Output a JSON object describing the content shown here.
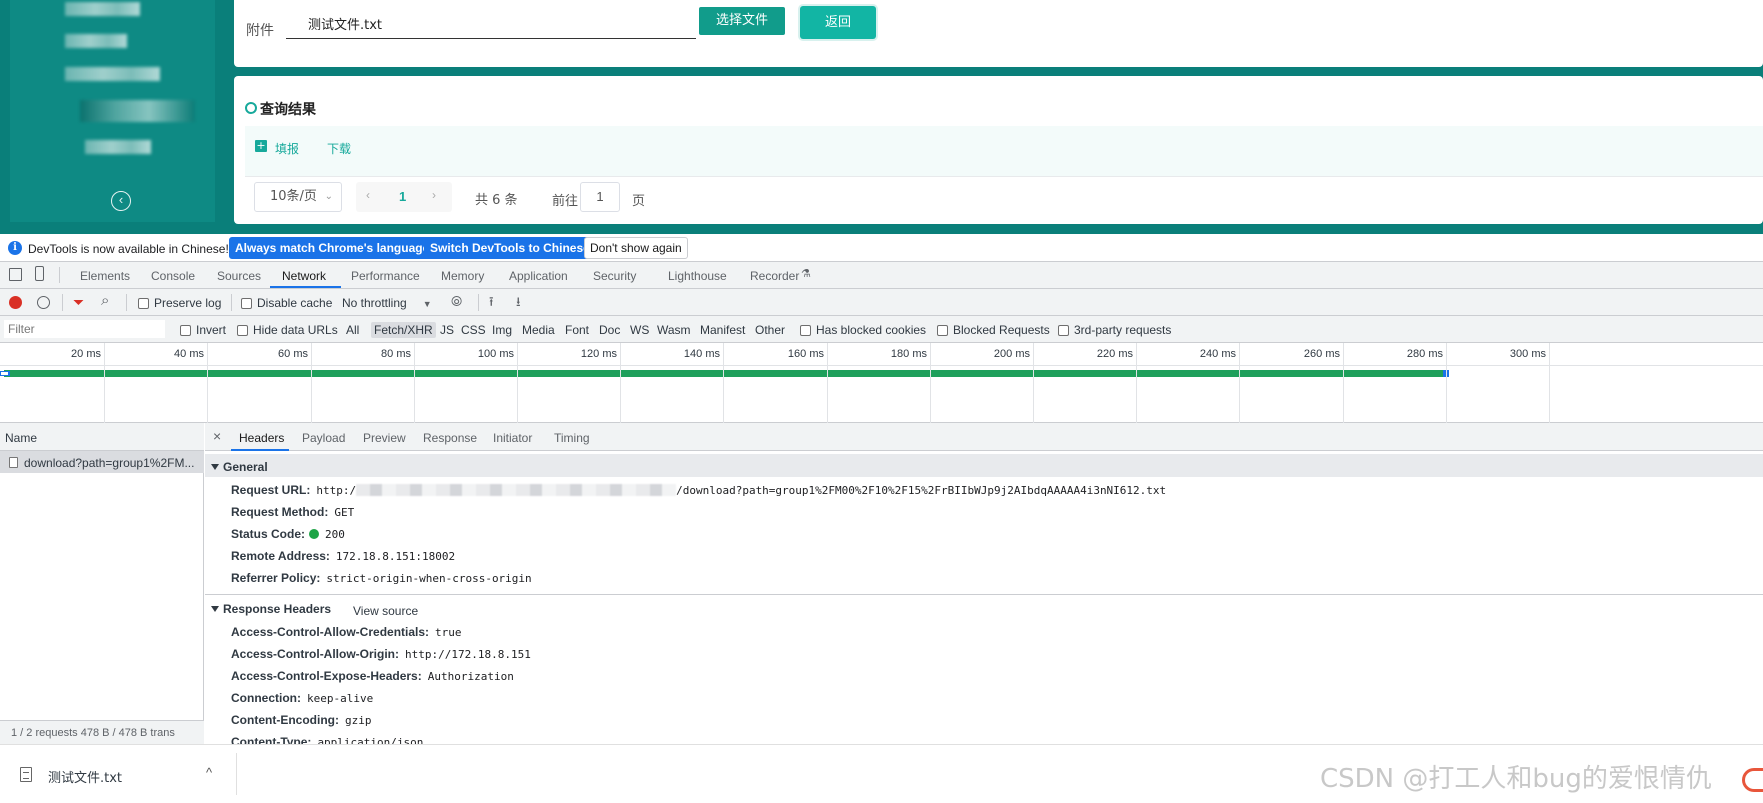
{
  "app": {
    "attachment_label": "附件",
    "file_value": "测试文件.txt",
    "choose_file_button": "选择文件",
    "back_button": "返回",
    "result_title": "查询结果",
    "fill_link": "填报",
    "download_link": "下载",
    "page_size": "10条/页",
    "prev_glyph": "‹",
    "next_glyph": "›",
    "current_page": "1",
    "total_text": "共 6 条",
    "goto_label": "前往",
    "goto_value": "1",
    "page_unit": "页",
    "collapse_glyph": "‹"
  },
  "devtools": {
    "infobar": {
      "text": "DevTools is now available in Chinese!",
      "btn_match": "Always match Chrome's language",
      "btn_switch": "Switch DevTools to Chinese",
      "btn_dismiss": "Don't show again"
    },
    "tabs": [
      "Elements",
      "Console",
      "Sources",
      "Network",
      "Performance",
      "Memory",
      "Application",
      "Security",
      "Lighthouse",
      "Recorder"
    ],
    "active_tab": "Network",
    "toolbar": {
      "preserve_log": "Preserve log",
      "disable_cache": "Disable cache",
      "throttling": "No throttling"
    },
    "filter": {
      "placeholder": "Filter",
      "invert": "Invert",
      "hide_data_urls": "Hide data URLs",
      "types": [
        "All",
        "Fetch/XHR",
        "JS",
        "CSS",
        "Img",
        "Media",
        "Font",
        "Doc",
        "WS",
        "Wasm",
        "Manifest",
        "Other"
      ],
      "active_type": "Fetch/XHR",
      "has_blocked_cookies": "Has blocked cookies",
      "blocked_requests": "Blocked Requests",
      "third_party": "3rd-party requests"
    },
    "timeline": {
      "ticks": [
        "20 ms",
        "40 ms",
        "60 ms",
        "80 ms",
        "100 ms",
        "120 ms",
        "140 ms",
        "160 ms",
        "180 ms",
        "200 ms",
        "220 ms",
        "240 ms",
        "260 ms",
        "280 ms",
        "300 ms"
      ],
      "request_duration_ms": 280
    },
    "requests": {
      "header": "Name",
      "rows": [
        "download?path=group1%2FM..."
      ],
      "footer": "1 / 2 requests   478 B / 478 B trans"
    },
    "detail": {
      "close": "×",
      "tabs": [
        "Headers",
        "Payload",
        "Preview",
        "Response",
        "Initiator",
        "Timing"
      ],
      "active_tab": "Headers",
      "general_title": "General",
      "general": [
        {
          "k": "Request URL:",
          "v_prefix": "http:/",
          "v": "/download?path=group1%2FM00%2F10%2F15%2FrBIIbWJp9j2AIbdqAAAAA4i3nNI612.txt"
        },
        {
          "k": "Request Method:",
          "v": "GET"
        },
        {
          "k": "Status Code:",
          "v": "200"
        },
        {
          "k": "Remote Address:",
          "v": "172.18.8.151:18002"
        },
        {
          "k": "Referrer Policy:",
          "v": "strict-origin-when-cross-origin"
        }
      ],
      "response_title": "Response Headers",
      "view_source": "View source",
      "response": [
        {
          "k": "Access-Control-Allow-Credentials:",
          "v": "true"
        },
        {
          "k": "Access-Control-Allow-Origin:",
          "v": "http://172.18.8.151"
        },
        {
          "k": "Access-Control-Expose-Headers:",
          "v": "Authorization"
        },
        {
          "k": "Connection:",
          "v": "keep-alive"
        },
        {
          "k": "Content-Encoding:",
          "v": "gzip"
        },
        {
          "k": "Content-Type:",
          "v": "application/json"
        }
      ]
    }
  },
  "shelf": {
    "file_name": "测试文件.txt",
    "chevron": "^"
  },
  "watermark": "CSDN @打工人和bug的爱恨情仇"
}
